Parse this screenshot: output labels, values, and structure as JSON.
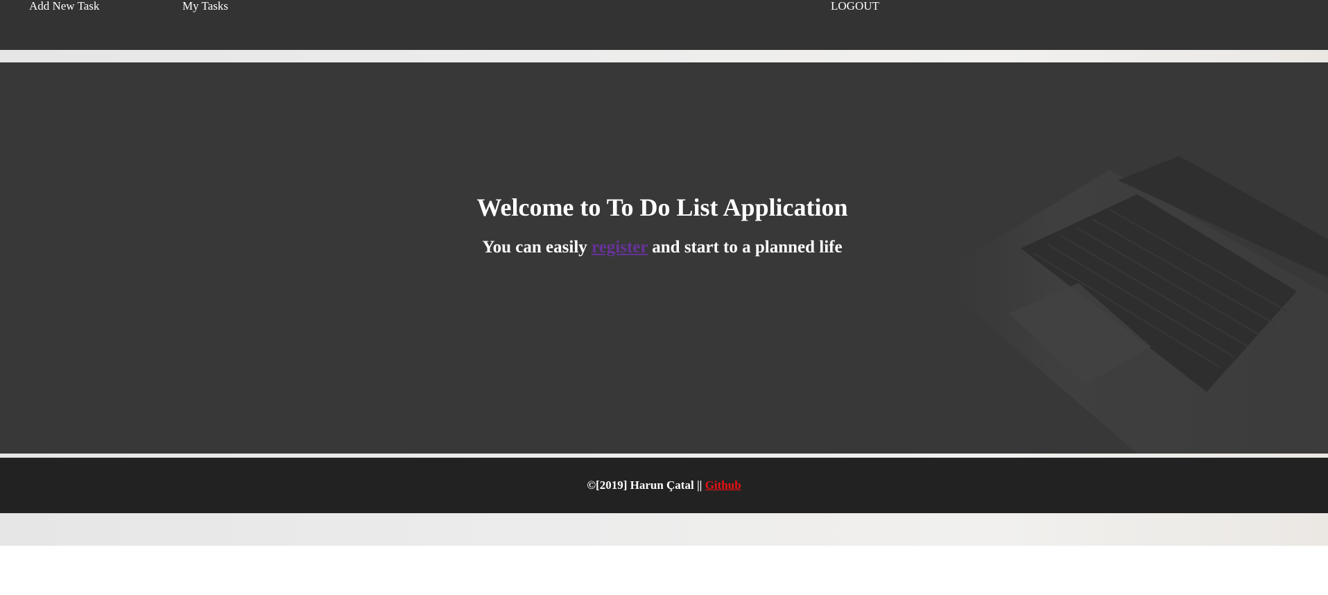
{
  "nav": {
    "add_task": "Add New Task",
    "my_tasks": "My Tasks",
    "logout": "LOGOUT"
  },
  "hero": {
    "title": "Welcome to To Do List Application",
    "subtitle_before": "You can easily ",
    "register_link": "register",
    "subtitle_after": " and start to a planned life"
  },
  "footer": {
    "copyright": "©[2019] Harun Çatal || ",
    "github_link": "Github"
  },
  "colors": {
    "navbar": "#333333",
    "hero": "#383838",
    "footer": "#222222",
    "register_link": "#663399",
    "github_link": "#ee1111"
  }
}
